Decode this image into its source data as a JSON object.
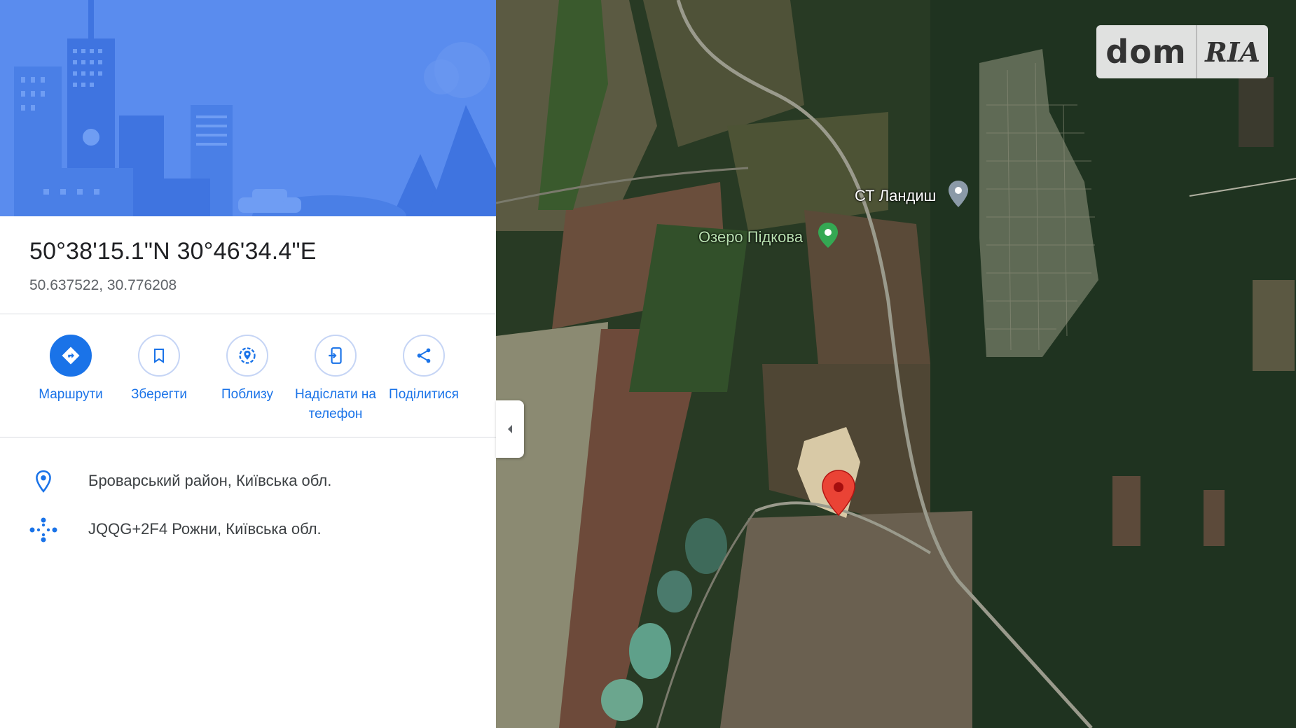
{
  "place": {
    "title": "50°38'15.1\"N 30°46'34.4\"E",
    "decimal": "50.637522, 30.776208"
  },
  "actions": [
    {
      "label": "Маршрути",
      "icon": "directions-icon"
    },
    {
      "label": "Зберегти",
      "icon": "bookmark-icon"
    },
    {
      "label": "Поблизу",
      "icon": "nearby-icon"
    },
    {
      "label": "Надіслати на телефон",
      "icon": "send-to-phone-icon"
    },
    {
      "label": "Поділитися",
      "icon": "share-icon"
    }
  ],
  "info": {
    "address": "Броварський район, Київська обл.",
    "plus_code": "JQQG+2F4 Рожни, Київська обл."
  },
  "map": {
    "labels": {
      "landysh": "СТ Ландиш",
      "lake": "Озеро Підкова"
    },
    "logo": {
      "dom": "dom",
      "ria": "RIA"
    }
  },
  "colors": {
    "accent": "#1a73e8",
    "pin": "#ea4335",
    "park": "#34a853"
  }
}
